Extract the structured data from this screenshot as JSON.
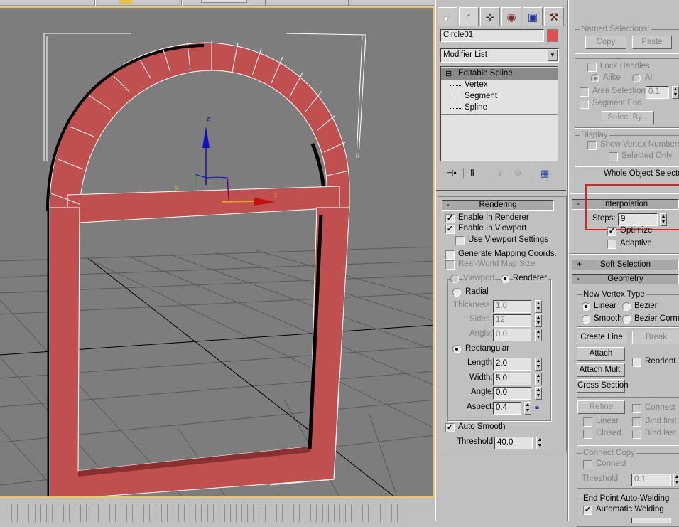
{
  "viewport": {
    "gizmo_labels": {
      "x": "x",
      "y": "y",
      "z": "z"
    },
    "object_color": "#c05050",
    "highlight_color": "#e8c860"
  },
  "panel": {
    "tabs": [
      {
        "name": "create",
        "icon": "create-icon"
      },
      {
        "name": "modify",
        "icon": "modify-icon"
      },
      {
        "name": "hierarchy",
        "icon": "hierarchy-icon"
      },
      {
        "name": "motion",
        "icon": "motion-icon"
      },
      {
        "name": "display",
        "icon": "display-icon"
      },
      {
        "name": "utilities",
        "icon": "utilities-icon"
      }
    ],
    "object_name": "Circle01",
    "object_color": "#e05050",
    "modifier_list": "Modifier List",
    "stack": {
      "root": "Editable Spline",
      "sub": [
        "Vertex",
        "Segment",
        "Spline"
      ]
    },
    "rendering": {
      "title": "Rendering",
      "sign": "-",
      "enable_renderer": "Enable In Renderer",
      "enable_viewport": "Enable In Viewport",
      "use_viewport_settings": "Use Viewport Settings",
      "gen_mapping": "Generate Mapping Coords.",
      "real_world": "Real-World Map Size",
      "viewport_radio": "Viewport",
      "renderer_radio": "Renderer",
      "radial": "Radial",
      "thickness_label": "Thickness:",
      "thickness": "1.0",
      "sides_label": "Sides:",
      "sides": "12",
      "angle_label": "Angle:",
      "radial_angle": "0.0",
      "rectangular": "Rectangular",
      "length_label": "Length:",
      "length": "2.0",
      "width_label": "Width:",
      "width": "5.0",
      "rect_angle": "0.0",
      "aspect_label": "Aspect:",
      "aspect": "0.4",
      "auto_smooth": "Auto Smooth",
      "threshold_label": "Threshold:",
      "threshold": "40.0"
    },
    "selection": {
      "named_selections": "Named Selections:",
      "copy": "Copy",
      "paste": "Paste",
      "lock_handles": "Lock Handles",
      "alike": "Alike",
      "all": "All",
      "area_selection": "Area Selection:",
      "area_value": "0.1",
      "segment_end": "Segment End",
      "select_by": "Select By...",
      "display": "Display",
      "show_vertex_numbers": "Show Vertex Numbers",
      "selected_only": "Selected Only",
      "status": "Whole Object Selected"
    },
    "interpolation": {
      "title": "Interpolation",
      "sign": "-",
      "steps_label": "Steps:",
      "steps": "9",
      "optimize": "Optimize",
      "adaptive": "Adaptive",
      "highlight_color": "#e02020"
    },
    "soft_selection": {
      "title": "Soft Selection",
      "sign": "+"
    },
    "geometry": {
      "title": "Geometry",
      "sign": "-",
      "new_vertex_type": "New Vertex Type",
      "linear": "Linear",
      "bezier": "Bezier",
      "smooth": "Smooth",
      "bezier_corner": "Bezier Corner",
      "create_line": "Create Line",
      "break": "Break",
      "attach": "Attach",
      "reorient": "Reorient",
      "attach_mult": "Attach Mult.",
      "cross_section": "Cross Section",
      "refine": "Refine",
      "connect": "Connect",
      "linear_cb": "Linear",
      "bind_first": "Bind first",
      "closed": "Closed",
      "bind_last": "Bind last",
      "connect_copy": "Connect Copy",
      "connect_copy_cb": "Connect",
      "threshold_label": "Threshold",
      "threshold": "0.1",
      "end_point_welding": "End Point Auto-Welding",
      "automatic_welding": "Automatic Welding"
    }
  }
}
